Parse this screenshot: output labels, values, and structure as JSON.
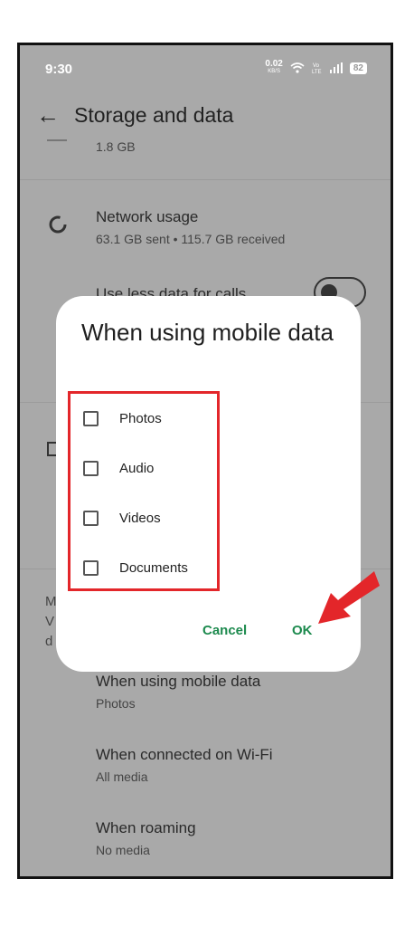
{
  "status_bar": {
    "time": "9:30",
    "net_speed": "0.02",
    "net_unit": "KB/S",
    "battery": "82"
  },
  "header": {
    "title": "Storage and data"
  },
  "background": {
    "storage_size": "1.8 GB",
    "network_usage_title": "Network usage",
    "network_usage_detail": "63.1 GB sent • 115.7 GB received",
    "use_less_data_title": "Use less data for calls",
    "left_letters": [
      "M",
      "V",
      "d"
    ],
    "mobile_data_title": "When using mobile data",
    "mobile_data_value": "Photos",
    "wifi_title": "When connected on Wi-Fi",
    "wifi_value": "All media",
    "roaming_title": "When roaming",
    "roaming_value": "No media"
  },
  "dialog": {
    "title": "When using mobile data",
    "options": [
      "Photos",
      "Audio",
      "Videos",
      "Documents"
    ],
    "cancel_label": "Cancel",
    "ok_label": "OK"
  },
  "colors": {
    "overlay": "#a9a9a9",
    "accent_green": "#1d8a4e",
    "highlight_red": "#e3262a"
  }
}
